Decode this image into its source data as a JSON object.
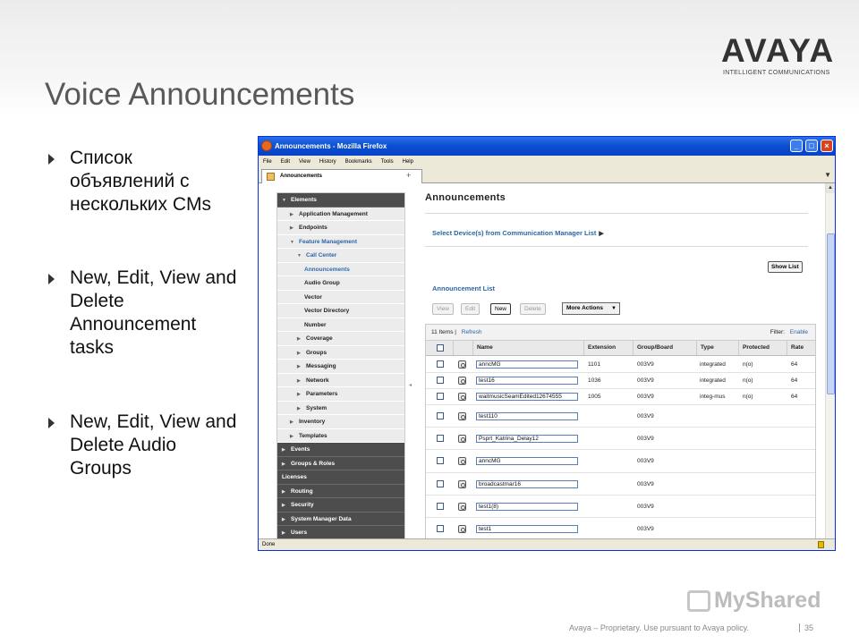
{
  "slide": {
    "title": "Voice Announcements",
    "logo": "AVAYA",
    "logo_tagline": "INTELLIGENT COMMUNICATIONS",
    "bullets": [
      "Список объявлений с нескольких CMs",
      "New, Edit, View and Delete Announcement tasks",
      "New, Edit, View and Delete Audio Groups"
    ],
    "footer": "Avaya – Proprietary. Use pursuant to Avaya policy.",
    "page_number": "35",
    "watermark": "MyShared"
  },
  "browser": {
    "title": "Announcements - Mozilla Firefox",
    "menu": [
      "File",
      "Edit",
      "View",
      "History",
      "Bookmarks",
      "Tools",
      "Help"
    ],
    "tab_label": "Announcements",
    "tab_plus": "+",
    "status": "Done"
  },
  "nav": {
    "items": [
      {
        "label": "Elements",
        "style": "dark",
        "expanded": true,
        "indent": 0
      },
      {
        "label": "Application Management",
        "indent": 1
      },
      {
        "label": "Endpoints",
        "indent": 1
      },
      {
        "label": "Feature Management",
        "indent": 1,
        "expanded": true,
        "style": "blue"
      },
      {
        "label": "Call Center",
        "indent": 2,
        "expanded": true,
        "style": "blue"
      },
      {
        "label": "Announcements",
        "indent": 3,
        "style": "sel"
      },
      {
        "label": "Audio Group",
        "indent": 3
      },
      {
        "label": "Vector",
        "indent": 3
      },
      {
        "label": "Vector Directory",
        "indent": 3
      },
      {
        "label": "Number",
        "indent": 3
      },
      {
        "label": "Coverage",
        "indent": 2
      },
      {
        "label": "Groups",
        "indent": 2
      },
      {
        "label": "Messaging",
        "indent": 2
      },
      {
        "label": "Network",
        "indent": 2
      },
      {
        "label": "Parameters",
        "indent": 2
      },
      {
        "label": "System",
        "indent": 2
      },
      {
        "label": "Inventory",
        "indent": 1
      },
      {
        "label": "Templates",
        "indent": 1
      },
      {
        "label": "Events",
        "style": "dark",
        "indent": 0
      },
      {
        "label": "Groups & Roles",
        "style": "dark",
        "indent": 0
      },
      {
        "label": "Licenses",
        "style": "dark",
        "indent": 0,
        "noarrow": true
      },
      {
        "label": "Routing",
        "style": "dark",
        "indent": 0
      },
      {
        "label": "Security",
        "style": "dark",
        "indent": 0
      },
      {
        "label": "System Manager Data",
        "style": "dark",
        "indent": 0
      },
      {
        "label": "Users",
        "style": "dark",
        "indent": 0
      }
    ]
  },
  "main": {
    "heading": "Announcements",
    "select_devices": "Select Device(s) from Communication Manager List",
    "show_list": "Show List",
    "list_title": "Announcement List",
    "buttons": {
      "view": "View",
      "edit": "Edit",
      "new": "New",
      "delete": "Delete",
      "more": "More Actions"
    },
    "item_count": "11 Items",
    "refresh": "Refresh",
    "filter_label": "Filter:",
    "filter_link": "Enable",
    "columns": [
      "Name",
      "Extension",
      "Group/Board",
      "Type",
      "Protected",
      "Rate"
    ],
    "rows": [
      {
        "name": "anncMG",
        "extension": "1101",
        "group": "003V9",
        "type": "integrated",
        "protected": "n(o)",
        "rate": "64"
      },
      {
        "name": "test16",
        "extension": "1036",
        "group": "003V9",
        "type": "integrated",
        "protected": "n(o)",
        "rate": "64"
      },
      {
        "name": "waitmusicSeamEdited12674555",
        "extension": "1005",
        "group": "003V9",
        "type": "integ-mus",
        "protected": "n(o)",
        "rate": "64"
      },
      {
        "name": "test110",
        "extension": "",
        "group": "003V9",
        "type": "",
        "protected": "",
        "rate": ""
      },
      {
        "name": "Psprt_Katrina_Delay12",
        "extension": "",
        "group": "003V9",
        "type": "",
        "protected": "",
        "rate": ""
      },
      {
        "name": "anncMG",
        "extension": "",
        "group": "003V9",
        "type": "",
        "protected": "",
        "rate": ""
      },
      {
        "name": "broadcastmar16",
        "extension": "",
        "group": "003V9",
        "type": "",
        "protected": "",
        "rate": ""
      },
      {
        "name": "test1(8)",
        "extension": "",
        "group": "003V9",
        "type": "",
        "protected": "",
        "rate": ""
      },
      {
        "name": "test1",
        "extension": "",
        "group": "003V9",
        "type": "",
        "protected": "",
        "rate": ""
      }
    ]
  }
}
